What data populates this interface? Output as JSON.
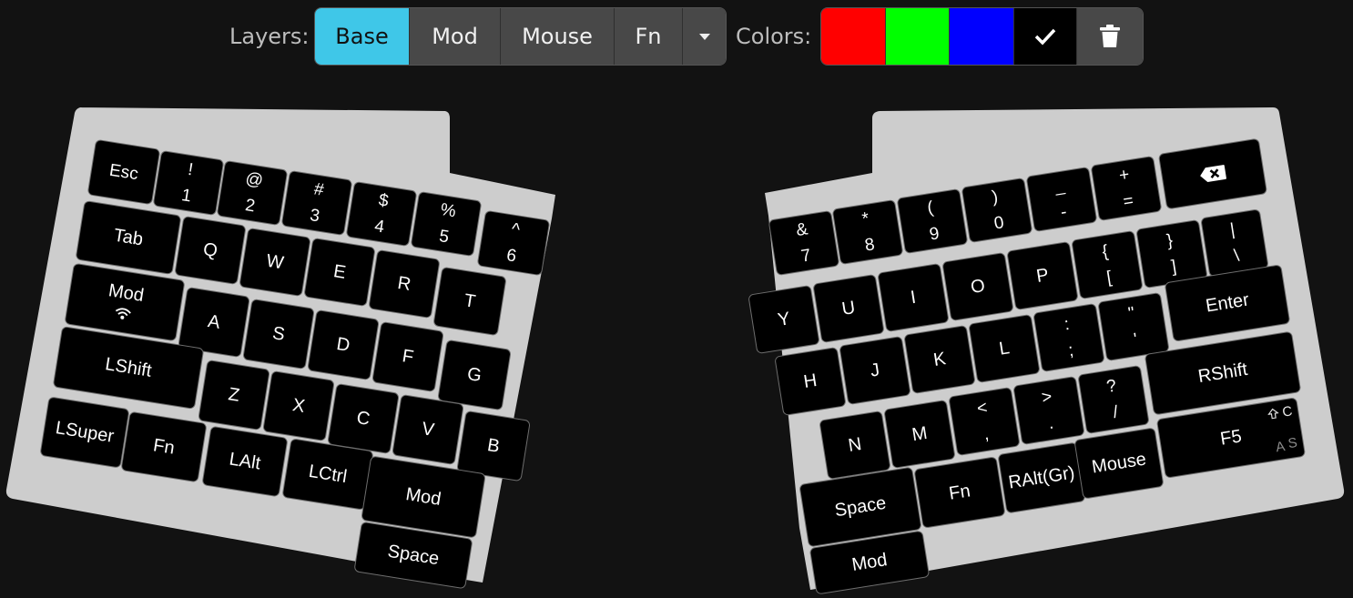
{
  "toolbar": {
    "layers_label": "Layers:",
    "layers": [
      "Base",
      "Mod",
      "Mouse",
      "Fn"
    ],
    "active_layer": "Base",
    "colors_label": "Colors:",
    "colors": [
      "#ff0000",
      "#00ff00",
      "#0000ff",
      "#000000"
    ]
  },
  "left": {
    "row0": [
      {
        "top": "",
        "bot": "Esc"
      },
      {
        "top": "!",
        "bot": "1"
      },
      {
        "top": "@",
        "bot": "2"
      },
      {
        "top": "#",
        "bot": "3"
      },
      {
        "top": "$",
        "bot": "4"
      },
      {
        "top": "%",
        "bot": "5"
      },
      {
        "top": "^",
        "bot": "6"
      }
    ],
    "row1": [
      "Tab",
      "Q",
      "W",
      "E",
      "R",
      "T"
    ],
    "row2": [
      "Mod",
      "A",
      "S",
      "D",
      "F",
      "G"
    ],
    "row3": [
      "LShift",
      "Z",
      "X",
      "C",
      "V",
      "B"
    ],
    "row4": [
      "LSuper",
      "Fn",
      "LAlt",
      "LCtrl",
      "Mod"
    ],
    "thumb": [
      "Space"
    ]
  },
  "right": {
    "row0": [
      {
        "top": "&",
        "bot": "7"
      },
      {
        "top": "*",
        "bot": "8"
      },
      {
        "top": "(",
        "bot": "9"
      },
      {
        "top": ")",
        "bot": "0"
      },
      {
        "top": "_",
        "bot": "-"
      },
      {
        "top": "+",
        "bot": "="
      }
    ],
    "row1": [
      {
        "t": "Y"
      },
      {
        "t": "U"
      },
      {
        "t": "I"
      },
      {
        "t": "O"
      },
      {
        "t": "P"
      },
      {
        "top": "{",
        "bot": "["
      },
      {
        "top": "}",
        "bot": "]"
      },
      {
        "top": "|",
        "bot": "\\"
      }
    ],
    "row2": [
      {
        "t": "H"
      },
      {
        "t": "J"
      },
      {
        "t": "K"
      },
      {
        "t": "L"
      },
      {
        "top": ":",
        "bot": ";"
      },
      {
        "top": "\"",
        "bot": "'"
      },
      {
        "t": "Enter"
      }
    ],
    "row3": [
      {
        "t": "N"
      },
      {
        "t": "M"
      },
      {
        "top": "<",
        "bot": ","
      },
      {
        "top": ">",
        "bot": "."
      },
      {
        "top": "?",
        "bot": "/"
      },
      {
        "t": "RShift"
      }
    ],
    "row4": [
      "Space",
      "Fn",
      "RAlt(Gr)",
      "Mouse",
      "F5"
    ],
    "thumb": [
      "Mod"
    ],
    "f5_corners": {
      "tr": "C",
      "bl": "A",
      "br": "S"
    }
  }
}
